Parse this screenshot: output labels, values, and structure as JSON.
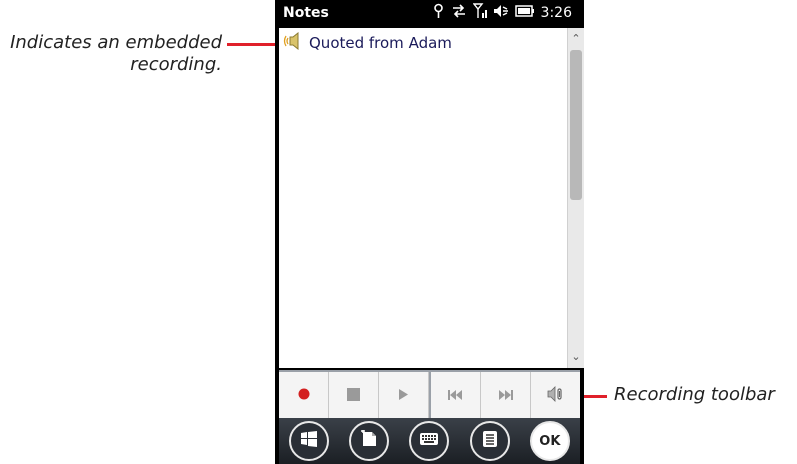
{
  "annotations": {
    "embedded_recording": "Indicates an embedded recording.",
    "recording_toolbar": "Recording toolbar",
    "line_color": "#e0202a"
  },
  "status_bar": {
    "title": "Notes",
    "time": "3:26",
    "icons": [
      "signal-tower-icon",
      "data-sync-icon",
      "signal-strength-icon",
      "volume-icon",
      "battery-icon"
    ]
  },
  "note": {
    "text": "Quoted from Adam",
    "icon": "embedded-recording-speaker-icon"
  },
  "toolbar": {
    "buttons": [
      "record-icon",
      "stop-icon",
      "play-icon",
      "previous-icon",
      "next-icon",
      "volume-icon"
    ],
    "record_color": "#d32020"
  },
  "softkeys": {
    "ok_label": "OK",
    "icons": [
      "windows-start-icon",
      "new-note-icon",
      "keyboard-icon",
      "menu-icon",
      "ok-icon"
    ]
  }
}
